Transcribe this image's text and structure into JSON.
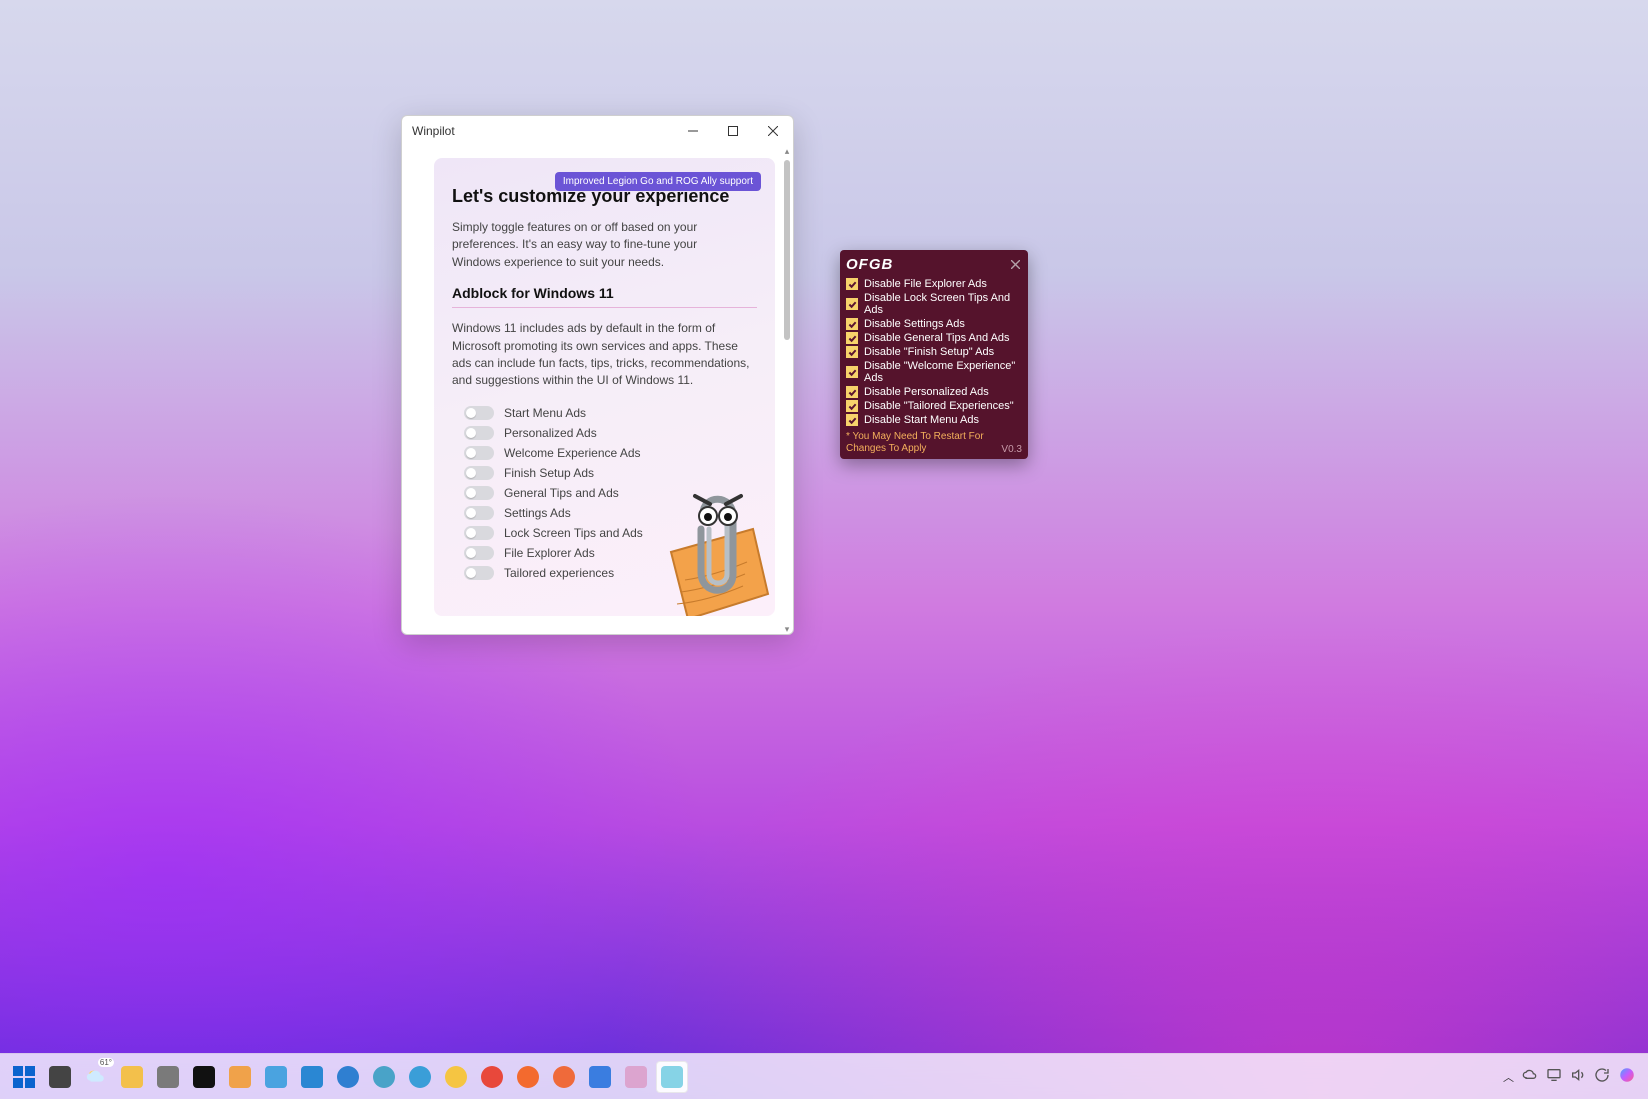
{
  "winpilot": {
    "title": "Winpilot",
    "badge": "Improved Legion Go and ROG Ally support",
    "heading": "Let's customize your experience",
    "intro": "Simply toggle features on or off based on your preferences. It's an easy way to fine-tune your Windows experience to suit your needs.",
    "section_title": "Adblock for Windows 11",
    "section_desc": "Windows 11 includes ads by default in the form of Microsoft promoting its own services and apps. These ads can include fun facts, tips, tricks, recommendations, and suggestions within the UI of Windows 11.",
    "toggles": [
      {
        "label": "Start Menu Ads"
      },
      {
        "label": "Personalized Ads"
      },
      {
        "label": "Welcome Experience Ads"
      },
      {
        "label": "Finish Setup Ads"
      },
      {
        "label": "General Tips and Ads"
      },
      {
        "label": "Settings Ads"
      },
      {
        "label": "Lock Screen Tips and Ads"
      },
      {
        "label": "File Explorer Ads"
      },
      {
        "label": "Tailored experiences"
      }
    ]
  },
  "ofgb": {
    "logo": "OFGB",
    "items": [
      "Disable File Explorer Ads",
      "Disable Lock Screen Tips And Ads",
      "Disable Settings Ads",
      "Disable General Tips And Ads",
      "Disable \"Finish Setup\" Ads",
      "Disable \"Welcome Experience\" Ads",
      "Disable Personalized Ads",
      "Disable \"Tailored Experiences\"",
      "Disable Start Menu Ads"
    ],
    "restart_notice": "* You May Need To Restart For Changes To Apply",
    "version": "V0.3"
  },
  "taskbar": {
    "weather_temp": "61°",
    "icons": [
      {
        "name": "start",
        "color": "#0b63ce"
      },
      {
        "name": "task-view",
        "color": "#444444"
      },
      {
        "name": "weather",
        "color": "#9ecff5"
      },
      {
        "name": "file-explorer",
        "color": "#f3c04b"
      },
      {
        "name": "settings",
        "color": "#7a7a7a"
      },
      {
        "name": "terminal",
        "color": "#111111"
      },
      {
        "name": "powershell",
        "color": "#f0a24a"
      },
      {
        "name": "phone-link",
        "color": "#4aa3e0"
      },
      {
        "name": "microsoft-store",
        "color": "#2a87d3"
      },
      {
        "name": "edge",
        "color": "#2f7fd1"
      },
      {
        "name": "edge-beta",
        "color": "#49a3c8"
      },
      {
        "name": "edge-dev",
        "color": "#3a9ed8"
      },
      {
        "name": "chrome-canary",
        "color": "#f5c542"
      },
      {
        "name": "chrome",
        "color": "#e8483b"
      },
      {
        "name": "firefox",
        "color": "#f36a2e"
      },
      {
        "name": "brave",
        "color": "#ef6a3a"
      },
      {
        "name": "sysinternals",
        "color": "#3a7de0"
      },
      {
        "name": "winpilot",
        "color": "#dca4cf"
      },
      {
        "name": "ofgb",
        "color": "#86d3e6"
      }
    ],
    "tray": {
      "chevron": "tray-overflow",
      "cloud": "onedrive-icon",
      "display": "display-icon",
      "sound": "sound-icon",
      "updates": "windows-update-icon",
      "copilot": "copilot-icon"
    }
  }
}
